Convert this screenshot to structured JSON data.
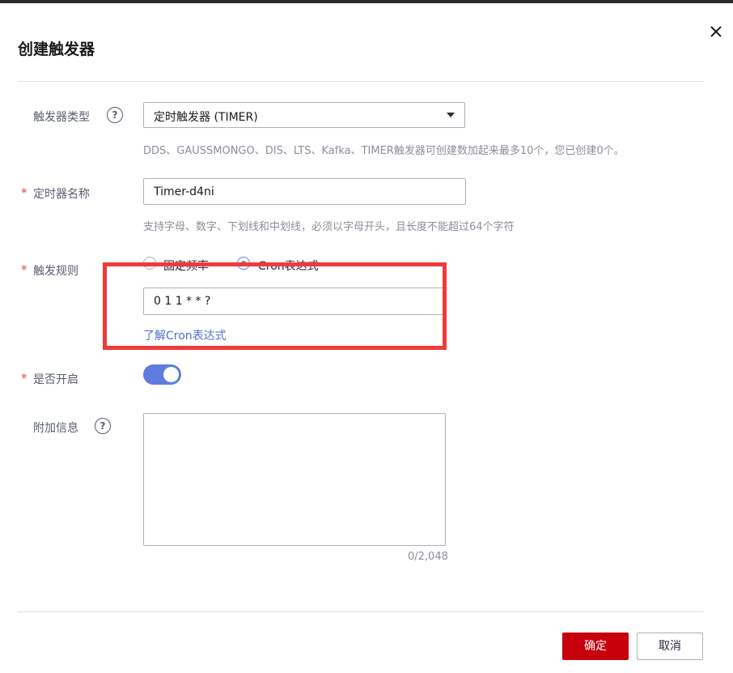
{
  "dialog": {
    "title": "创建触发器",
    "close_icon": "close-icon"
  },
  "form": {
    "trigger_type": {
      "label": "触发器类型",
      "help_icon": "question-circle-icon",
      "help_glyph": "?",
      "selected": "定时触发器 (TIMER)",
      "hint": "DDS、GAUSSMONGO、DIS、LTS、Kafka、TIMER触发器可创建数加起来最多10个，您已创建0个。"
    },
    "timer_name": {
      "required_mark": "*",
      "label": "定时器名称",
      "value": "Timer-d4ni",
      "hint": "支持字母、数字、下划线和中划线，必须以字母开头，且长度不能超过64个字符"
    },
    "trigger_rule": {
      "required_mark": "*",
      "label": "触发规则",
      "options": [
        {
          "label": "固定频率",
          "selected": false
        },
        {
          "label": "Cron表达式",
          "selected": true
        }
      ],
      "value": "0 1 1 * * ?",
      "link": "了解Cron表达式"
    },
    "enabled": {
      "required_mark": "*",
      "label": "是否开启",
      "on": true
    },
    "additional_info": {
      "label": "附加信息",
      "help_icon": "question-circle-icon",
      "help_glyph": "?",
      "value": "",
      "counter": "0/2,048"
    }
  },
  "footer": {
    "confirm": "确定",
    "cancel": "取消"
  },
  "colors": {
    "primary_button": "#c7000b",
    "accent": "#5e7ce0",
    "highlight_box": "#f03a3a"
  }
}
